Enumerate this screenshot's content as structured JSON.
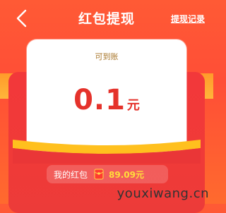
{
  "header": {
    "title": "红包提现",
    "history_label": "提现记录"
  },
  "card": {
    "arrive_label": "可到账",
    "amount": "0.1",
    "unit": "元"
  },
  "balance": {
    "label": "我的红包",
    "value": "89.09元"
  },
  "watermark": "youxiwang.cn",
  "colors": {
    "primary_red": "#f2383a",
    "header_orange": "#ff5a35",
    "amount_red": "#e5322b",
    "balance_yellow": "#ffde3a"
  },
  "icons": {
    "back": "chevron-left-icon",
    "envelope": "red-envelope-icon"
  }
}
